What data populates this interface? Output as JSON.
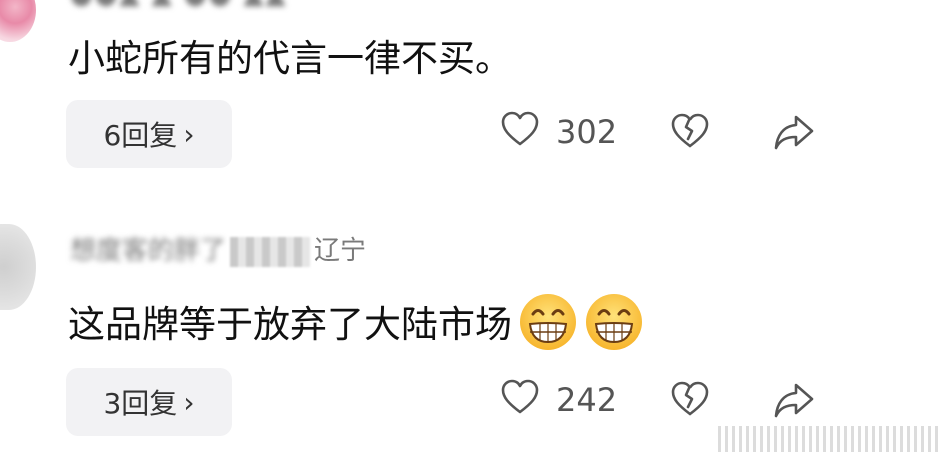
{
  "comments": [
    {
      "text": "小蛇所有的代言一律不买。",
      "replies_label": "6回复",
      "likes": "302"
    },
    {
      "user_location": "辽宁",
      "text": "这品牌等于放弃了大陆市场",
      "replies_label": "3回复",
      "likes": "242"
    }
  ],
  "icons": {
    "like": "heart-outline-icon",
    "dislike": "broken-heart-icon",
    "share": "share-arrow-icon",
    "emoji": "grinning-emoji"
  }
}
